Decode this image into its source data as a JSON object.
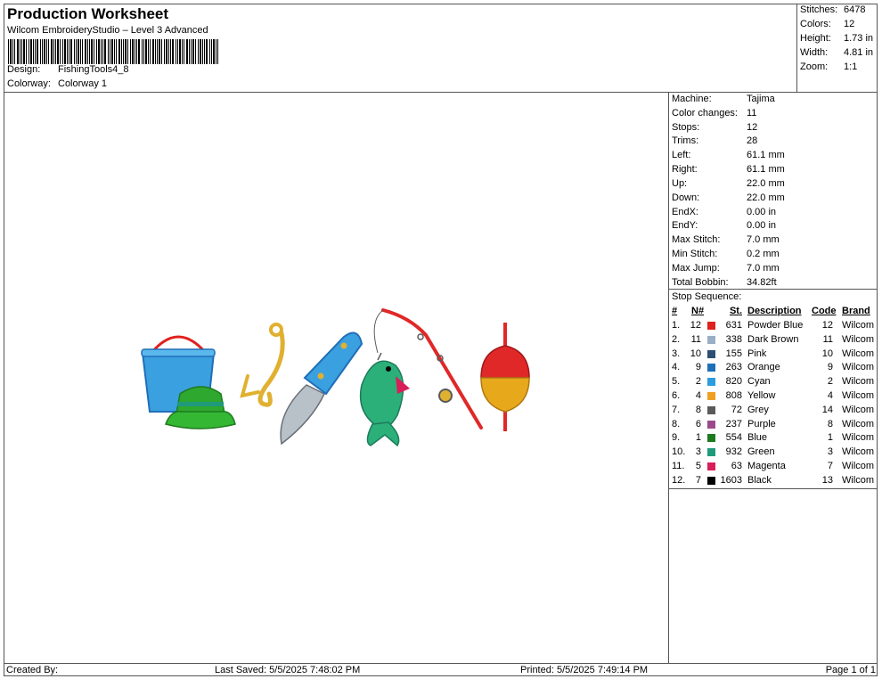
{
  "header": {
    "title": "Production Worksheet",
    "subtitle": "Wilcom EmbroideryStudio – Level 3 Advanced",
    "design_label": "Design:",
    "design_value": "FishingTools4_8",
    "colorway_label": "Colorway:",
    "colorway_value": "Colorway 1"
  },
  "summary": [
    {
      "label": "Stitches:",
      "value": "6478"
    },
    {
      "label": "Colors:",
      "value": "12"
    },
    {
      "label": "Height:",
      "value": "1.73 in"
    },
    {
      "label": "Width:",
      "value": "4.81 in"
    },
    {
      "label": "Zoom:",
      "value": "1:1"
    }
  ],
  "machine_info": [
    {
      "label": "Machine:",
      "value": "Tajima"
    },
    {
      "label": "Color changes:",
      "value": "11"
    },
    {
      "label": "Stops:",
      "value": "12"
    },
    {
      "label": "Trims:",
      "value": "28"
    },
    {
      "label": "Left:",
      "value": "61.1 mm"
    },
    {
      "label": "Right:",
      "value": "61.1 mm"
    },
    {
      "label": "Up:",
      "value": "22.0 mm"
    },
    {
      "label": "Down:",
      "value": "22.0 mm"
    },
    {
      "label": "EndX:",
      "value": "0.00 in"
    },
    {
      "label": "EndY:",
      "value": "0.00 in"
    },
    {
      "label": "Max Stitch:",
      "value": "7.0 mm"
    },
    {
      "label": "Min Stitch:",
      "value": "0.2 mm"
    },
    {
      "label": "Max Jump:",
      "value": "7.0 mm"
    },
    {
      "label": "Total Bobbin:",
      "value": "34.82ft"
    }
  ],
  "stop_sequence": {
    "title": "Stop Sequence:",
    "headers": {
      "num": "#",
      "n": "N#",
      "st": "St.",
      "desc": "Description",
      "code": "Code",
      "brand": "Brand"
    },
    "rows": [
      {
        "num": "1.",
        "n": "12",
        "color": "#e0201e",
        "st": "631",
        "desc": "Powder Blue",
        "code": "12",
        "brand": "Wilcom"
      },
      {
        "num": "2.",
        "n": "11",
        "color": "#9aaec6",
        "st": "338",
        "desc": "Dark Brown",
        "code": "11",
        "brand": "Wilcom"
      },
      {
        "num": "3.",
        "n": "10",
        "color": "#2d4f72",
        "st": "155",
        "desc": "Pink",
        "code": "10",
        "brand": "Wilcom"
      },
      {
        "num": "4.",
        "n": "9",
        "color": "#1f6fb8",
        "st": "263",
        "desc": "Orange",
        "code": "9",
        "brand": "Wilcom"
      },
      {
        "num": "5.",
        "n": "2",
        "color": "#2b9ce0",
        "st": "820",
        "desc": "Cyan",
        "code": "2",
        "brand": "Wilcom"
      },
      {
        "num": "6.",
        "n": "4",
        "color": "#f0a020",
        "st": "808",
        "desc": "Yellow",
        "code": "4",
        "brand": "Wilcom"
      },
      {
        "num": "7.",
        "n": "8",
        "color": "#5a5a5a",
        "st": "72",
        "desc": "Grey",
        "code": "14",
        "brand": "Wilcom"
      },
      {
        "num": "8.",
        "n": "6",
        "color": "#9a4a8a",
        "st": "237",
        "desc": "Purple",
        "code": "8",
        "brand": "Wilcom"
      },
      {
        "num": "9.",
        "n": "1",
        "color": "#1e7a1e",
        "st": "554",
        "desc": "Blue",
        "code": "1",
        "brand": "Wilcom"
      },
      {
        "num": "10.",
        "n": "3",
        "color": "#1f9a7a",
        "st": "932",
        "desc": "Green",
        "code": "3",
        "brand": "Wilcom"
      },
      {
        "num": "11.",
        "n": "5",
        "color": "#d81e5a",
        "st": "63",
        "desc": "Magenta",
        "code": "7",
        "brand": "Wilcom"
      },
      {
        "num": "12.",
        "n": "7",
        "color": "#000000",
        "st": "1603",
        "desc": "Black",
        "code": "13",
        "brand": "Wilcom"
      }
    ]
  },
  "footer": {
    "created": "Created By:",
    "last_saved": "Last Saved: 5/5/2025 7:48:02 PM",
    "printed": "Printed: 5/5/2025 7:49:14 PM",
    "page": "Page 1 of 1"
  },
  "colors": {
    "border": "#555555",
    "bucket": "#3aa0e0",
    "hat": "#2ea82e",
    "hook": "#e0b030",
    "knife_handle": "#3aa0e0",
    "fish": "#2bb07a",
    "rod": "#e02828",
    "bobber_top": "#e02828",
    "bobber_bottom": "#e8a81c"
  }
}
